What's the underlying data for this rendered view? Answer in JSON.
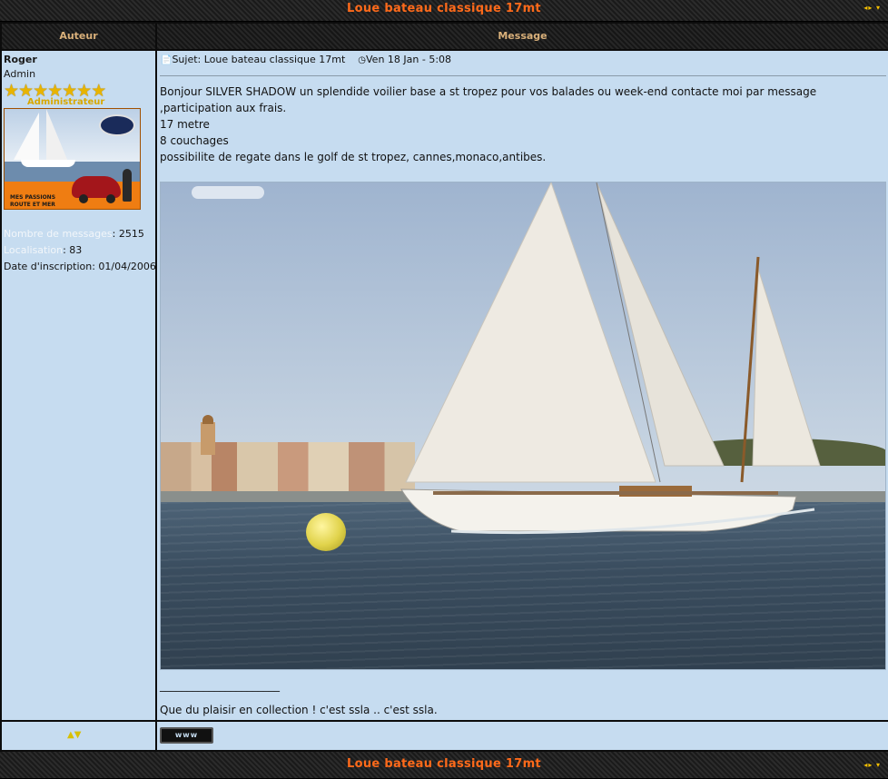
{
  "topic": {
    "title": "Loue bateau classique 17mt"
  },
  "columns": {
    "author": "Auteur",
    "message": "Message"
  },
  "author": {
    "username": "Roger",
    "rank": "Admin",
    "stars": "★★★★★★★",
    "rank_label": "Administrateur",
    "posts_label": "Nombre de messages",
    "posts_value": ": 2515",
    "location_label": "Localisation",
    "location_value": ": 83",
    "joined_label": "Date d'inscription",
    "joined_value": ": 01/04/2006",
    "avatar_caption_1": "MES PASSIONS",
    "avatar_caption_2": "ROUTE ET MER"
  },
  "post": {
    "subject": "Sujet: Loue bateau classique 17mt",
    "date": "Ven 18 Jan - 5:08",
    "body_lines": [
      "Bonjour SILVER SHADOW un splendide voilier base a st tropez pour vos balades ou week-end contacte moi par message",
      ",participation aux frais.",
      "17 metre",
      "8 couchages",
      "possibilite de regate dans le golf de st tropez, cannes,monaco,antibes."
    ],
    "signature_rule": "______________________",
    "signature": "Que du plaisir en collection ! c'est ssla .. c'est ssla."
  },
  "footer": {
    "www_label": "www",
    "arrows": "▲▼"
  },
  "nav": {
    "arrows": "◂▸ ▾"
  },
  "colors": {
    "title": "#ff6a1a",
    "cell_bg": "#c6dcf0",
    "header_text": "#d9b07a"
  }
}
